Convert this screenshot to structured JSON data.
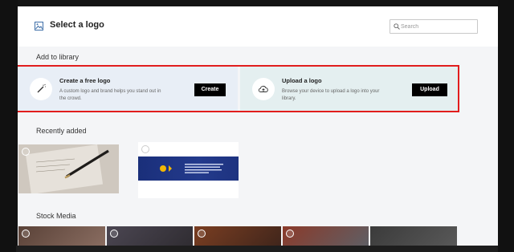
{
  "modal": {
    "title": "Select a logo",
    "close_label": "×",
    "search": {
      "placeholder": "Search",
      "value": ""
    }
  },
  "add_to_library": {
    "heading": "Add to library",
    "create_card": {
      "title": "Create a free logo",
      "description": "A custom logo and brand helps you stand out in the crowd.",
      "button": "Create"
    },
    "upload_card": {
      "title": "Upload a logo",
      "description": "Browse your device to upload a logo into your library.",
      "button": "Upload"
    }
  },
  "recently_added": {
    "heading": "Recently added",
    "items": [
      {
        "name": "pen-and-paper-photo"
      },
      {
        "name": "social-campaign-banner"
      }
    ]
  },
  "stock_media": {
    "heading": "Stock Media"
  },
  "colors": {
    "highlight_border": "#e11d1d",
    "button_bg": "#000000",
    "create_card_bg": "#e8eef6",
    "upload_card_bg": "#e4eff0"
  }
}
